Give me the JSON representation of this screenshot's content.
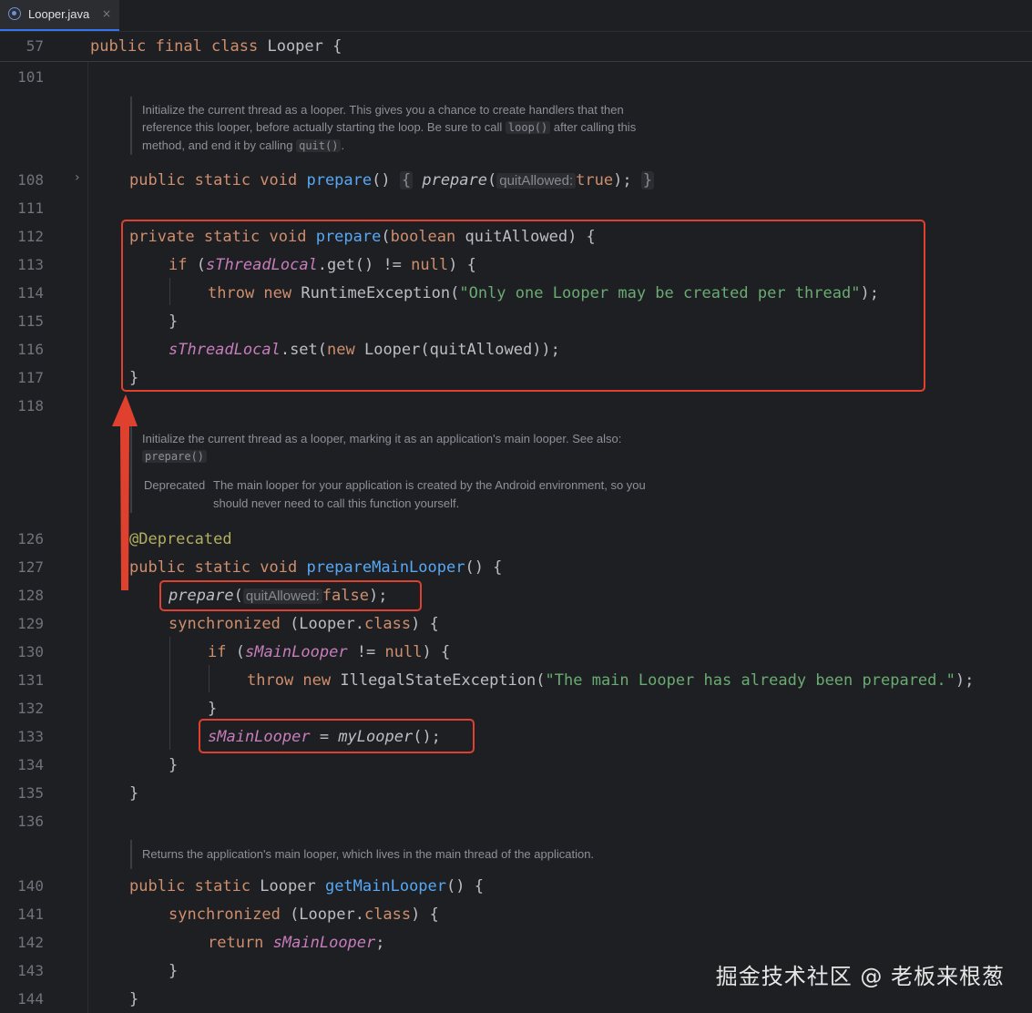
{
  "tab": {
    "label": "Looper.java",
    "close": "×"
  },
  "sticky": {
    "line": "57",
    "code": "public final class Looper {"
  },
  "line_numbers": [
    "101",
    "108",
    "111",
    "112",
    "113",
    "114",
    "115",
    "116",
    "117",
    "118",
    "126",
    "127",
    "128",
    "129",
    "130",
    "131",
    "132",
    "133",
    "134",
    "135",
    "136",
    "140",
    "141",
    "142",
    "143",
    "144"
  ],
  "docs": {
    "prepare_doc": {
      "l1": "Initialize the current thread as a looper. This gives you a chance to create handlers that then",
      "l2a": "reference this looper, before actually starting the loop. Be sure to call ",
      "l2code": "loop()",
      "l2b": " after calling this",
      "l3a": "method, and end it by calling ",
      "l3code": "quit()",
      "l3b": "."
    },
    "main_doc": {
      "l1": "Initialize the current thread as a looper, marking it as an application's main looper. See also:",
      "l2code": "prepare()",
      "dep_label": "Deprecated",
      "dep1": "The main looper for your application is created by the Android environment, so you",
      "dep2": "should never need to call this function yourself."
    },
    "getmain_doc": {
      "l1": "Returns the application's main looper, which lives in the main thread of the application."
    }
  },
  "code": {
    "l108": {
      "a": "public static void ",
      "fn": "prepare",
      "b": "() ",
      "open": "{",
      "call": "prepare",
      "p": "(",
      "hint": "quitAllowed:",
      "val": "true",
      "end": ");",
      "close": "}"
    },
    "l112": {
      "a": "private static void ",
      "fn": "prepare",
      "b": "(",
      "kw": "boolean",
      "c": " quitAllowed) {"
    },
    "l113": {
      "kw": "if",
      "a": " (",
      "st": "sThreadLocal",
      "b": ".get() != ",
      "kw2": "null",
      "c": ") {"
    },
    "l114": {
      "kw": "throw new",
      "a": " RuntimeException(",
      "str": "\"Only one Looper may be created per thread\"",
      "b": ");"
    },
    "l115": "}",
    "l116": {
      "st": "sThreadLocal",
      "a": ".set(",
      "kw": "new",
      "b": " Looper(quitAllowed));"
    },
    "l117": "}",
    "l126": "@Deprecated",
    "l127": {
      "a": "public static void ",
      "fn": "prepareMainLooper",
      "b": "() {"
    },
    "l128": {
      "call": "prepare",
      "p": "(",
      "hint": "quitAllowed:",
      "val": "false",
      "end": ");"
    },
    "l129": {
      "kw": "synchronized",
      "a": " (Looper.",
      "kw2": "class",
      "b": ") {"
    },
    "l130": {
      "kw": "if",
      "a": " (",
      "st": "sMainLooper",
      "b": " != ",
      "kw2": "null",
      "c": ") {"
    },
    "l131": {
      "kw": "throw new",
      "a": " IllegalStateException(",
      "str": "\"The main Looper has already been prepared.\"",
      "b": ");"
    },
    "l132": "}",
    "l133": {
      "st": "sMainLooper",
      "a": " = ",
      "call": "myLooper",
      "b": "();"
    },
    "l134": "}",
    "l135": "}",
    "l140": {
      "a": "public static ",
      "kw_type": "Looper ",
      "fn": "getMainLooper",
      "b": "() {"
    },
    "l141": {
      "kw": "synchronized",
      "a": " (Looper.",
      "kw2": "class",
      "b": ") {"
    },
    "l142": {
      "kw": "return",
      "a": " ",
      "st": "sMainLooper",
      "b": ";"
    },
    "l143": "}",
    "l144": "}"
  },
  "watermark": "掘金技术社区 @ 老板来根葱",
  "colors": {
    "background": "#1e1f22",
    "keyword": "#cf8e6d",
    "function": "#56a8f5",
    "static_field": "#c77dbb",
    "string": "#6aab73",
    "annotation": "#b3ae60",
    "highlight_box": "#e0412f"
  }
}
